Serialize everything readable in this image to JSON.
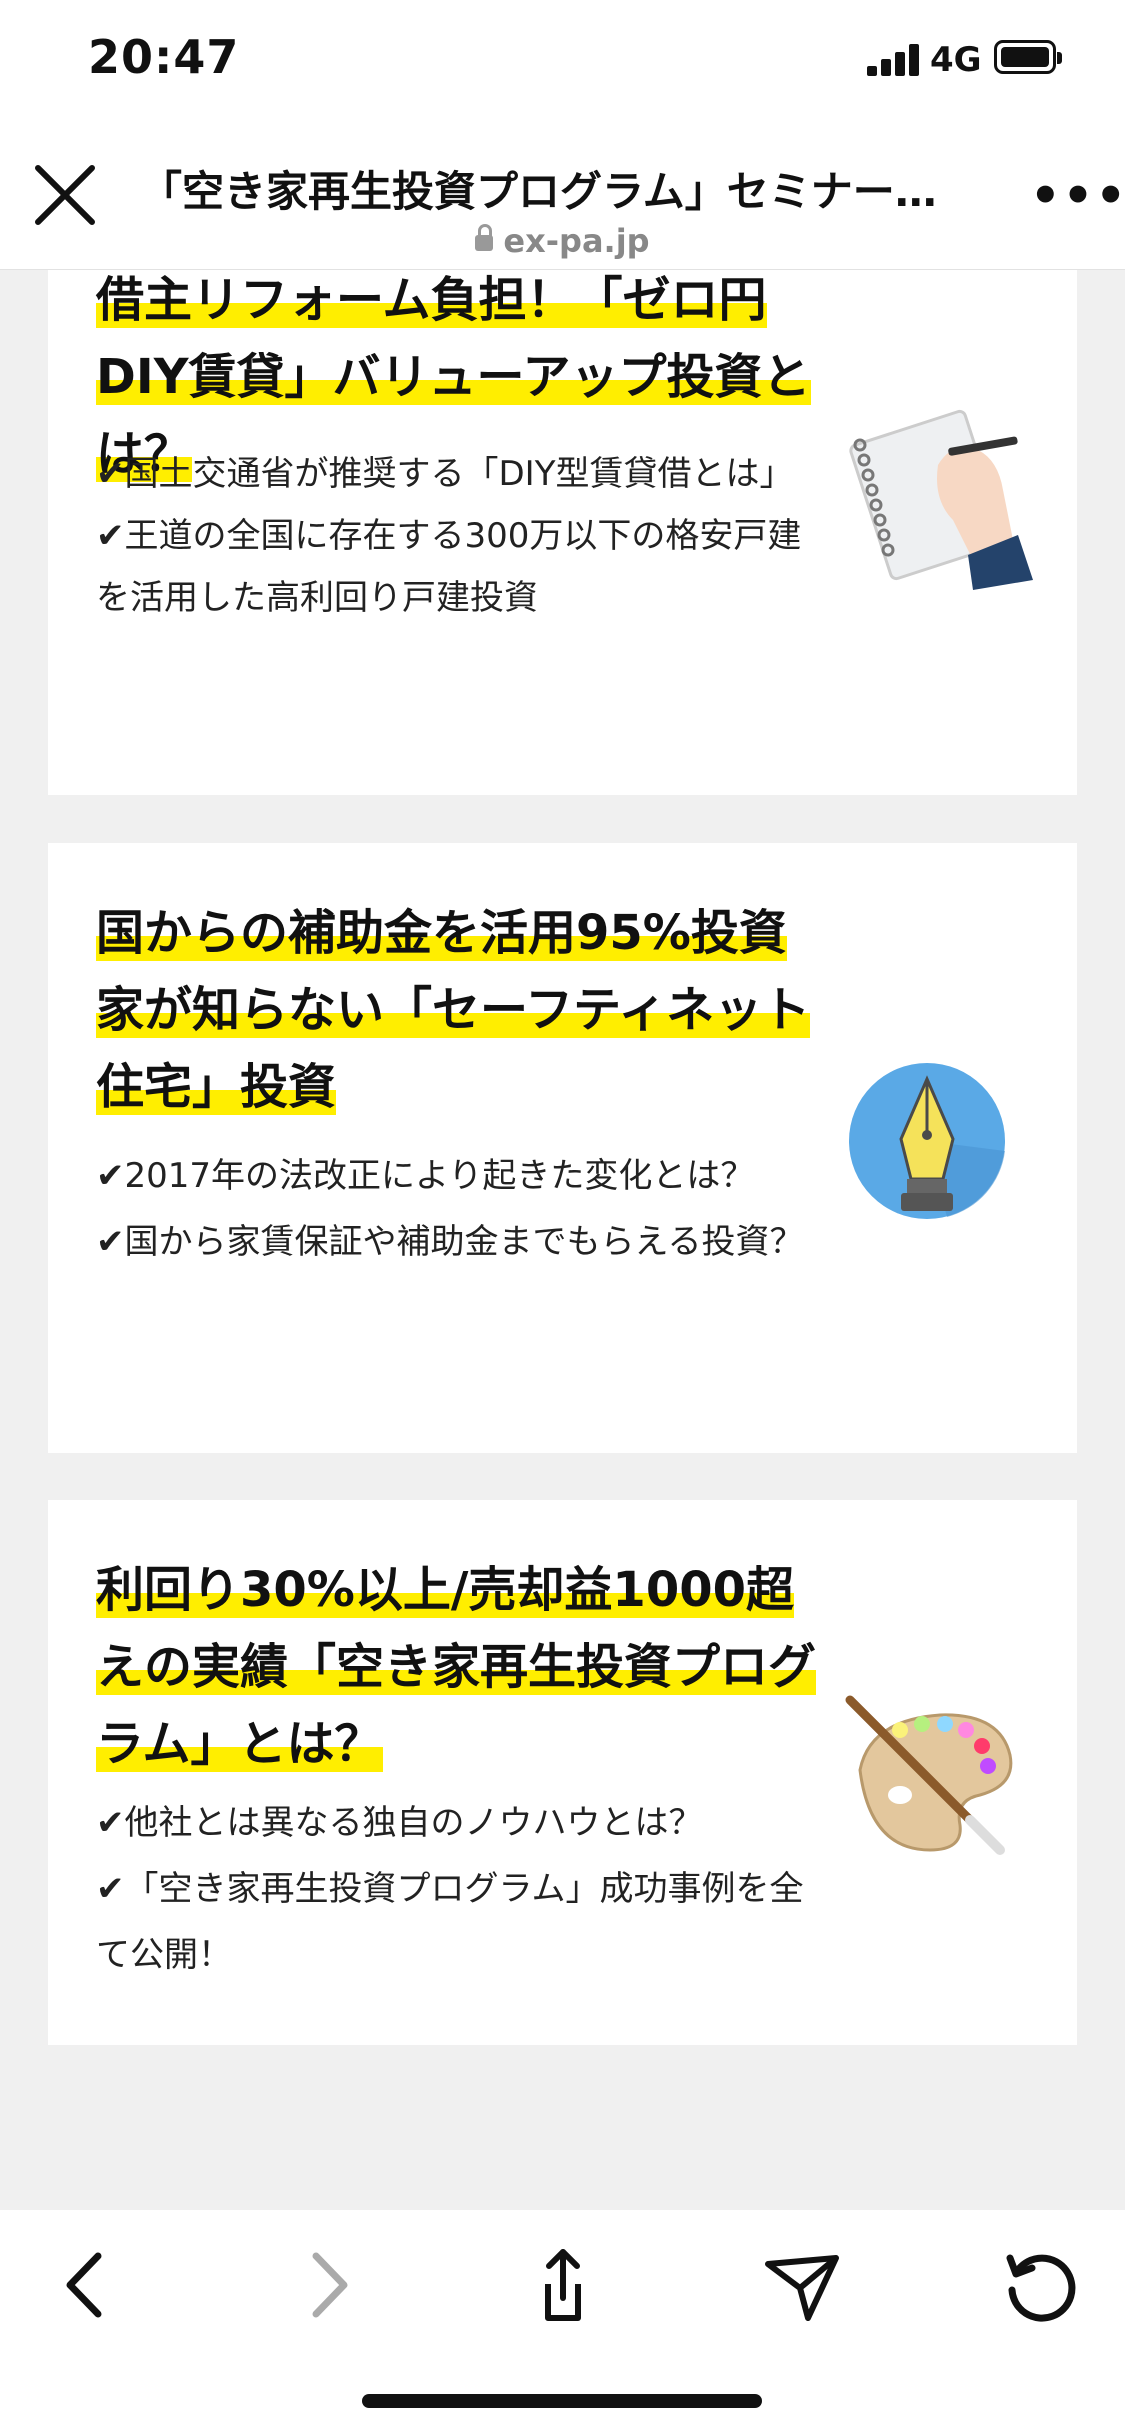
{
  "status_bar": {
    "time": "20:47",
    "network": "4G"
  },
  "browser": {
    "title": "「空き家再生投資プログラム」セミナー…",
    "url": "ex-pa.jp"
  },
  "cards": [
    {
      "heading": "借主リフォーム負担！「ゼロ円DIY賃貸」バリューアップ投資とは？",
      "bullets": [
        "✔国土交通省が推奨する「DIY型賃貸借とは」",
        "✔王道の全国に存在する300万以下の格安戸建を活用した高利回り戸建投資"
      ],
      "icon": "notebook-hand-icon"
    },
    {
      "heading": "国からの補助金を活用95%投資家が知らない「セーフティネット住宅」投資",
      "bullets": [
        "✔2017年の法改正により起きた変化とは？",
        "✔国から家賃保証や補助金までもらえる投資？"
      ],
      "icon": "fountain-pen-icon"
    },
    {
      "heading": "利回り30%以上/売却益1000超えの実績「空き家再生投資プログラム」とは？",
      "bullets": [
        "✔他社とは異なる独自のノウハウとは？",
        "✔「空き家再生投資プログラム」成功事例を全て公開！"
      ],
      "icon": "paint-palette-icon"
    }
  ],
  "colors": {
    "highlight": "#ffee00",
    "band": "#0a61b5",
    "background": "#f0f0f0"
  }
}
